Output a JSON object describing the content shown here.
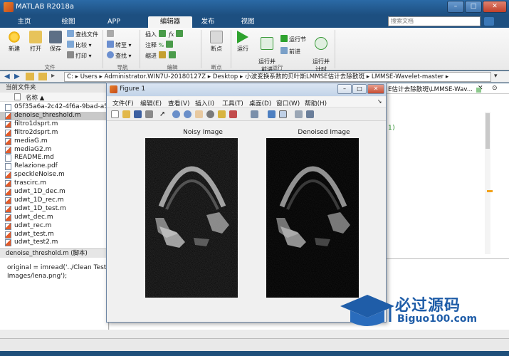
{
  "app": {
    "title": "MATLAB R2018a"
  },
  "ribbon_tabs": [
    "主页",
    "绘图",
    "APP",
    "编辑器",
    "发布",
    "视图"
  ],
  "help_search": {
    "placeholder": "搜索文档"
  },
  "ribbon": {
    "file_group": {
      "label": "文件",
      "new": "新建",
      "open": "打开",
      "save": "保存",
      "find_files": "查找文件",
      "compare": "比较",
      "print": "打印"
    },
    "nav_group": {
      "label": "导航",
      "goto": "转至",
      "find": "查找"
    },
    "edit_group": {
      "label": "编辑",
      "insert": "插入",
      "comment": "注释",
      "indent": "缩进"
    },
    "breakpoints_group": {
      "label": "断点",
      "breakpoints": "断点"
    },
    "run_group": {
      "label": "运行",
      "run": "运行",
      "run_and_advance": "运行并\n前进",
      "run_section": "运行节",
      "advance": "前进",
      "run_and_time": "运行并\n计时"
    }
  },
  "address_bar": {
    "path": [
      "C:",
      "Users",
      "Administrator.WIN7U-20180127Z",
      "Desktop",
      "小波变换系数的贝叶斯LMMSE估计去除散斑",
      "LMMSE-Wavelet-master"
    ]
  },
  "file_panel": {
    "header": "当前文件夹",
    "column_name": "名称 ▲",
    "files": [
      {
        "name": "05f35a6a-2c42-4f6a-9bad-a5",
        "type": "img",
        "selected": false
      },
      {
        "name": "denoise_threshold.m",
        "type": "m",
        "selected": true
      },
      {
        "name": "filtro1dsprt.m",
        "type": "m",
        "selected": false
      },
      {
        "name": "filtro2dsprt.m",
        "type": "m",
        "selected": false
      },
      {
        "name": "mediaG.m",
        "type": "m",
        "selected": false
      },
      {
        "name": "mediaG2.m",
        "type": "m",
        "selected": false
      },
      {
        "name": "README.md",
        "type": "txt",
        "selected": false
      },
      {
        "name": "Relazione.pdf",
        "type": "txt",
        "selected": false
      },
      {
        "name": "speckleNoise.m",
        "type": "m",
        "selected": false
      },
      {
        "name": "trascirc.m",
        "type": "m",
        "selected": false
      },
      {
        "name": "udwt_1D_dec.m",
        "type": "m",
        "selected": false
      },
      {
        "name": "udwt_1D_rec.m",
        "type": "m",
        "selected": false
      },
      {
        "name": "udwt_1D_test.m",
        "type": "m",
        "selected": false
      },
      {
        "name": "udwt_dec.m",
        "type": "m",
        "selected": false
      },
      {
        "name": "udwt_rec.m",
        "type": "m",
        "selected": false
      },
      {
        "name": "udwt_test.m",
        "type": "m",
        "selected": false
      },
      {
        "name": "udwt_test2.m",
        "type": "m",
        "selected": false
      }
    ],
    "details_header": "denoise_threshold.m   (脚本)",
    "details_text": "original = imread('../Clean Test Images/lena.png');"
  },
  "editor_right": {
    "tab_title": "E估计去除散斑\\LMMSE-Wav...",
    "code_snippet": "1)"
  },
  "figure": {
    "title": "Figure 1",
    "menu": [
      "文件(F)",
      "编辑(E)",
      "查看(V)",
      "插入(I)",
      "工具(T)",
      "桌面(D)",
      "窗口(W)",
      "帮助(H)"
    ],
    "axes": [
      {
        "title": "Noisy Image"
      },
      {
        "title": "Denoised Image"
      }
    ]
  },
  "watermark": {
    "text": "必过源码",
    "sub": "Biguo100.com"
  },
  "colors": {
    "title_bar": "#2b6aa6",
    "ribbon_tab_bg": "#1d4f80",
    "selected_file": "#c9c9c9",
    "watermark": "#1f5da8"
  }
}
